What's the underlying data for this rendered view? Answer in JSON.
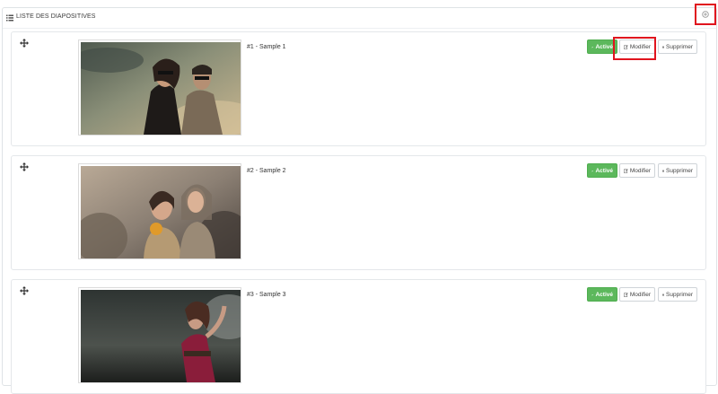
{
  "panel": {
    "title": "LISTE DES DIAPOSITIVES"
  },
  "slides": [
    {
      "title": "#1 - Sample 1",
      "status_label": "Activé",
      "edit_label": "Modifier",
      "delete_label": "Supprimer"
    },
    {
      "title": "#2 - Sample 2",
      "status_label": "Activé",
      "edit_label": "Modifier",
      "delete_label": "Supprimer"
    },
    {
      "title": "#3 - Sample 3",
      "status_label": "Activé",
      "edit_label": "Modifier",
      "delete_label": "Supprimer"
    }
  ],
  "icons": {
    "heading": "list-icon",
    "add": "add-circle-icon",
    "drag": "move-icon",
    "status": "check-icon",
    "edit": "pencil-icon",
    "delete": "trash-icon"
  },
  "colors": {
    "active_green": "#5cb85c",
    "highlight_red": "#e0141e"
  }
}
